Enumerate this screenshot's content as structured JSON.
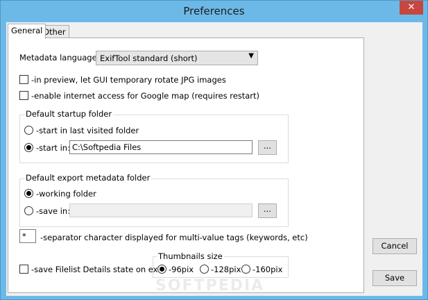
{
  "window": {
    "title": "Preferences",
    "close_glyph": "✕"
  },
  "tabs": [
    {
      "label": "General",
      "active": true
    },
    {
      "label": "Other",
      "active": false
    }
  ],
  "general": {
    "metadata_language": {
      "label": "Metadata language:",
      "value": "ExifTool standard (short)"
    },
    "rotate_jpg": {
      "label": "-in preview, let GUI temporary rotate JPG images",
      "checked": false
    },
    "internet_access": {
      "label": "-enable internet access for Google map (requires restart)",
      "checked": false
    },
    "startup_folder": {
      "title": "Default startup folder",
      "last_visited_label": "-start in last visited folder",
      "start_in_label": "-start in:",
      "start_in_value": "C:\\Softpedia Files",
      "selected": "start_in",
      "browse_label": "..."
    },
    "export_folder": {
      "title": "Default export metadata folder",
      "working_label": "-working folder",
      "save_in_label": "-save in:",
      "save_in_value": "",
      "selected": "working",
      "browse_label": "..."
    },
    "separator": {
      "value": "*",
      "label": "-separator character displayed for multi-value tags (keywords, etc)"
    },
    "save_details": {
      "label": "-save Filelist Details state on exit",
      "checked": false
    },
    "thumbnails": {
      "title": "Thumbnails size",
      "options": [
        "-96pix",
        "-128pix",
        "-160pix"
      ],
      "selected": "-96pix"
    }
  },
  "buttons": {
    "cancel": "Cancel",
    "save": "Save"
  },
  "watermark": "SOFTPEDIA"
}
